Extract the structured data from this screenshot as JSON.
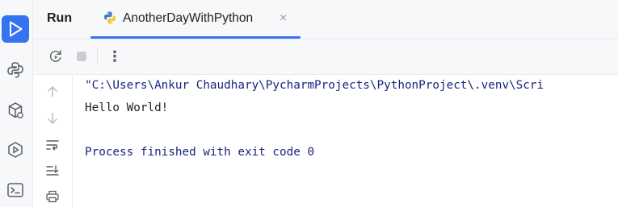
{
  "panel": {
    "title": "Run",
    "tab": {
      "label": "AnotherDayWithPython",
      "close_glyph": "×"
    }
  },
  "left_bar": {
    "items": [
      "run-icon",
      "python-console-icon",
      "python-packages-icon",
      "services-icon",
      "terminal-icon"
    ]
  },
  "toolbar": {
    "rerun_icon": "rerun-icon",
    "stop_icon": "stop-icon",
    "more_glyph": "⋮"
  },
  "gutter": {
    "items": [
      "arrow-up-icon",
      "arrow-down-icon",
      "soft-wrap-icon",
      "scroll-to-end-icon",
      "print-icon"
    ]
  },
  "console": {
    "command": "\"C:\\Users\\Ankur Chaudhary\\PycharmProjects\\PythonProject\\.venv\\Scri",
    "output": "Hello World!",
    "exit_message": "Process finished with exit code 0"
  },
  "colors": {
    "accent": "#3574f0",
    "console_system_text": "#1a237e",
    "panel_background": "#f7f8fa"
  }
}
